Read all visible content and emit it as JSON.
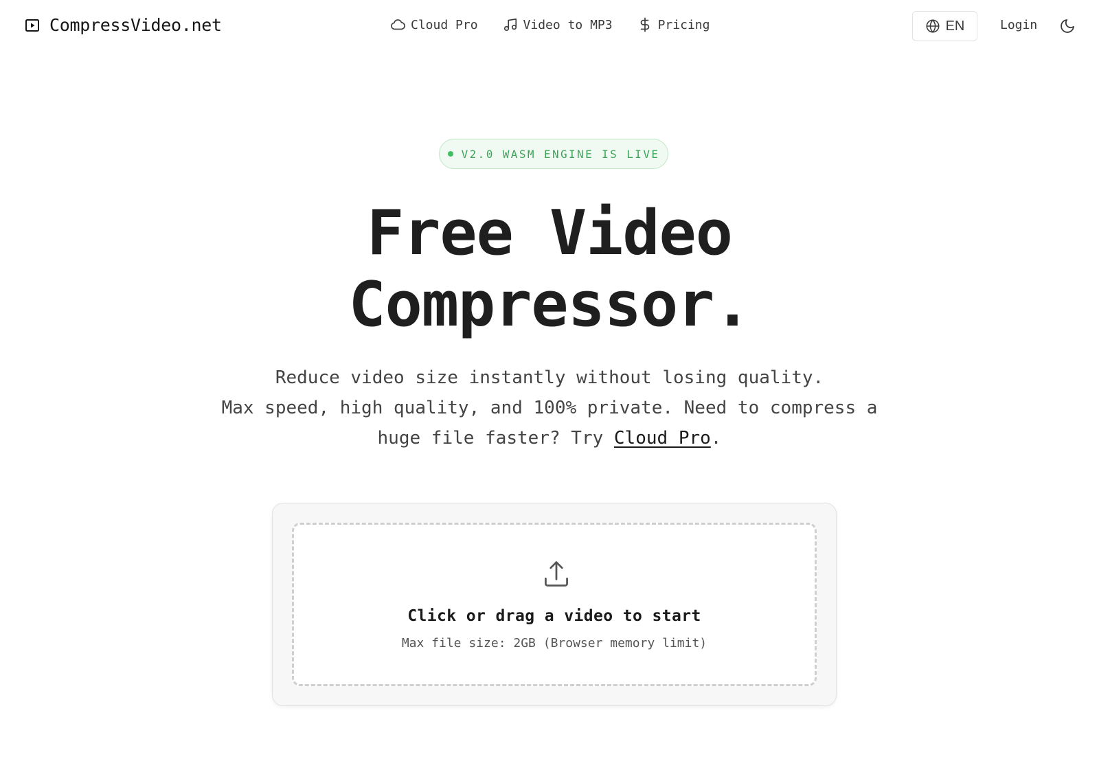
{
  "header": {
    "brand": "CompressVideo.net",
    "nav": [
      {
        "label": "Cloud Pro",
        "icon": "cloud-icon"
      },
      {
        "label": "Video to MP3",
        "icon": "music-note-icon"
      },
      {
        "label": "Pricing",
        "icon": "dollar-icon"
      }
    ],
    "language": "EN",
    "login": "Login",
    "theme_icon": "moon-icon"
  },
  "hero": {
    "badge": "V2.0 WASM ENGINE IS LIVE",
    "title_line1": "Free Video",
    "title_line2": "Compressor.",
    "subtitle_line1": "Reduce video size instantly without losing quality.",
    "subtitle_line2": "Max speed, high quality, and 100% private. Need to compress a",
    "subtitle_line3_prefix": "huge file faster? Try ",
    "subtitle_link": "Cloud Pro",
    "subtitle_line3_suffix": "."
  },
  "upload": {
    "icon": "upload-icon",
    "title": "Click or drag a video to start",
    "hint": "Max file size: 2GB (Browser memory limit)"
  },
  "colors": {
    "accent_green": "#3fa55a",
    "badge_bg": "#f0faf2",
    "text_dark": "#1f1f1f",
    "text_muted": "#444444"
  }
}
